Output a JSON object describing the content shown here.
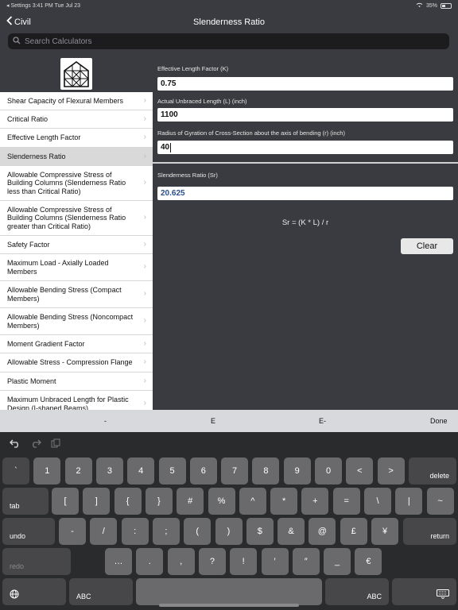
{
  "status": {
    "left": "◂ Settings  3:41 PM  Tue Jul 23",
    "battery": "35%"
  },
  "nav": {
    "back_label": "Civil",
    "title": "Slenderness Ratio"
  },
  "search": {
    "placeholder": "Search Calculators"
  },
  "sidebar": {
    "items": [
      {
        "label": "Shear Capacity of Flexural Members"
      },
      {
        "label": "Critical Ratio"
      },
      {
        "label": "Effective Length Factor"
      },
      {
        "label": "Slenderness Ratio",
        "selected": true
      },
      {
        "label": "Allowable Compressive Stress of Building Columns (Slenderness Ratio less than Critical Ratio)"
      },
      {
        "label": "Allowable Compressive Stress of Building Columns (Slenderness Ratio greater than Critical Ratio)"
      },
      {
        "label": "Safety Factor"
      },
      {
        "label": "Maximum Load - Axially Loaded Members"
      },
      {
        "label": "Allowable Bending Stress (Compact Members)"
      },
      {
        "label": "Allowable Bending Stress (Noncompact Members)"
      },
      {
        "label": "Moment Gradient Factor"
      },
      {
        "label": "Allowable Stress - Compression Flange"
      },
      {
        "label": "Plastic Moment"
      },
      {
        "label": "Maximum Unbraced Length for Plastic Design (I-shaped Beams)"
      }
    ]
  },
  "form": {
    "k_label": "Effective Length Factor (K)",
    "k_value": "0.75",
    "l_label": "Actual Unbraced Length (L) (inch)",
    "l_value": "1100",
    "r_label": "Radius of Gyration of Cross-Section about the axis of bending (r) (inch)",
    "r_value": "40",
    "sr_label": "Slenderness Ratio (Sr)",
    "sr_value": "20.625",
    "formula": "Sr = (K * L) / r",
    "clear_label": "Clear"
  },
  "accessory": {
    "minus": "-",
    "e": "E",
    "e_minus": "E-",
    "done": "Done"
  },
  "keyboard": {
    "row1": [
      "`",
      "1",
      "2",
      "3",
      "4",
      "5",
      "6",
      "7",
      "8",
      "9",
      "0",
      "<",
      ">"
    ],
    "delete": "delete",
    "tab": "tab",
    "row2": [
      "[",
      "]",
      "{",
      "}",
      "#",
      "%",
      "^",
      "*",
      "+",
      "=",
      "\\",
      "|",
      "~"
    ],
    "undo": "undo",
    "row3": [
      "-",
      "/",
      ":",
      ";",
      "(",
      ")",
      "$",
      "&",
      "@",
      "£",
      "¥"
    ],
    "return": "return",
    "redo": "redo",
    "row4": [
      "…",
      ".",
      ",",
      "?",
      "!",
      "′",
      "″",
      "_",
      "€"
    ],
    "abc": "ABC"
  }
}
